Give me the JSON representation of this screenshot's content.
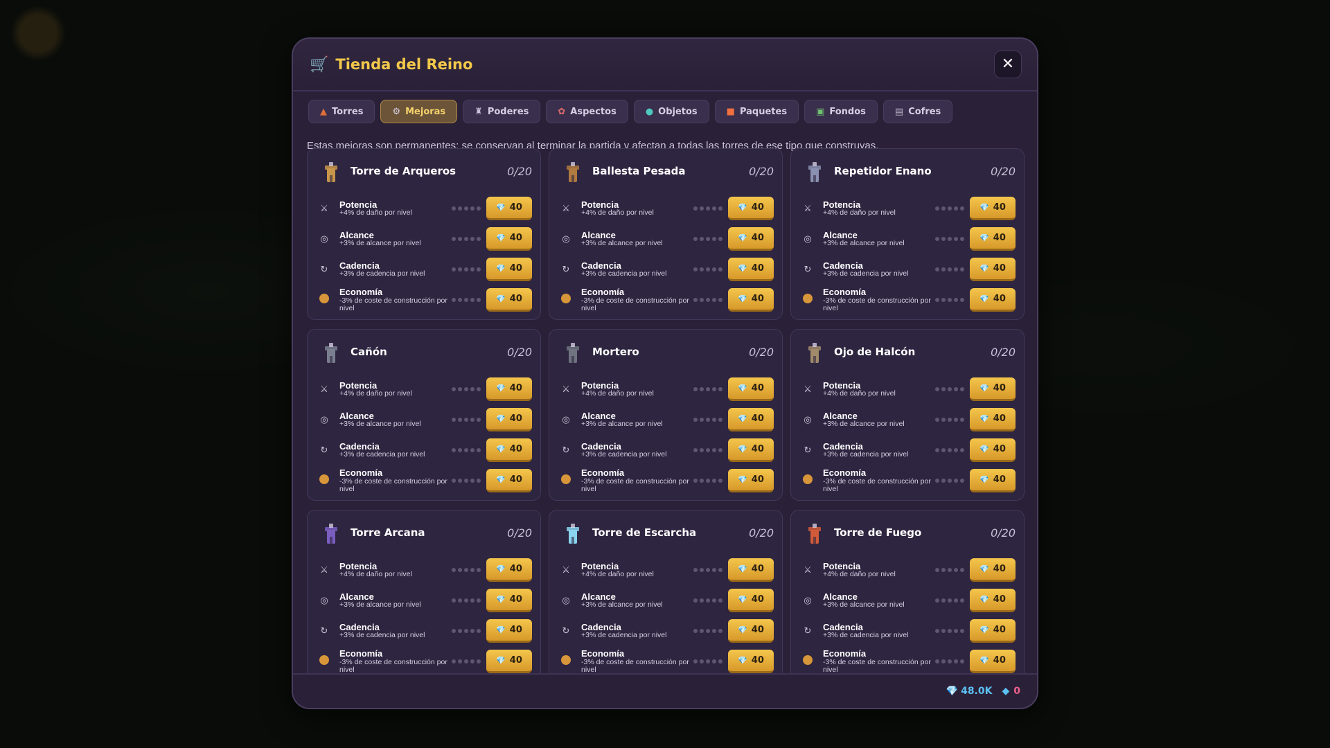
{
  "title": "Tienda del Reino",
  "icons": {
    "cart": "shopping-cart-icon",
    "close": "close-icon"
  },
  "close_label": "✕",
  "tabs": [
    {
      "label": "Torres",
      "icon": "tower-icon",
      "glyph": "▲",
      "color": "#e0703a",
      "active": false
    },
    {
      "label": "Mejoras",
      "icon": "gear-icon",
      "glyph": "⚙",
      "color": "#d8cfe6",
      "active": true
    },
    {
      "label": "Poderes",
      "icon": "power-icon",
      "glyph": "♜",
      "color": "#c9bfd8",
      "active": false
    },
    {
      "label": "Aspectos",
      "icon": "palette-icon",
      "glyph": "✿",
      "color": "#e06c6c",
      "active": false
    },
    {
      "label": "Objetos",
      "icon": "potion-icon",
      "glyph": "●",
      "color": "#4fc8c0",
      "active": false
    },
    {
      "label": "Paquetes",
      "icon": "gift-icon",
      "glyph": "■",
      "color": "#f07040",
      "active": false
    },
    {
      "label": "Fondos",
      "icon": "landscape-icon",
      "glyph": "▣",
      "color": "#6fc070",
      "active": false
    },
    {
      "label": "Cofres",
      "icon": "chest-icon",
      "glyph": "▤",
      "color": "#b9b0c8",
      "active": false
    }
  ],
  "info": "Estas mejoras son permanentes: se conservan al terminar la partida y afectan a todas las torres de ese tipo que construyas.",
  "cards": [
    {
      "name": "Torre de Arqueros",
      "level": "0/20",
      "icon": "archer-tower-icon",
      "color": "#c8964a"
    },
    {
      "name": "Ballesta Pesada",
      "level": "0/20",
      "icon": "ballista-icon",
      "color": "#b07a40"
    },
    {
      "name": "Repetidor Enano",
      "level": "0/20",
      "icon": "dwarf-repeater-icon",
      "color": "#8a90b0"
    },
    {
      "name": "Cañón",
      "level": "0/20",
      "icon": "cannon-icon",
      "color": "#7a7f90"
    },
    {
      "name": "Mortero",
      "level": "0/20",
      "icon": "mortar-icon",
      "color": "#6f7480"
    },
    {
      "name": "Ojo de Halcón",
      "level": "0/20",
      "icon": "hawk-eye-icon",
      "color": "#a08a6a"
    },
    {
      "name": "Torre Arcana",
      "level": "0/20",
      "icon": "arcane-tower-icon",
      "color": "#7a5fc0"
    },
    {
      "name": "Torre de Escarcha",
      "level": "0/20",
      "icon": "frost-tower-icon",
      "color": "#8ad4f0"
    },
    {
      "name": "Torre de Fuego",
      "level": "0/20",
      "icon": "fire-tower-icon",
      "color": "#d05a3a"
    }
  ],
  "upgrades": [
    {
      "name": "Potencia",
      "desc": "+4% de daño por nivel",
      "icon": "crossed-swords-icon",
      "glyph": "⚔",
      "progress": 0,
      "max": 5,
      "price": "40"
    },
    {
      "name": "Alcance",
      "desc": "+3% de alcance por nivel",
      "icon": "target-icon",
      "glyph": "◎",
      "progress": 0,
      "max": 5,
      "price": "40"
    },
    {
      "name": "Cadencia",
      "desc": "+3% de cadencia por nivel",
      "icon": "refresh-icon",
      "glyph": "↻",
      "progress": 0,
      "max": 5,
      "price": "40"
    },
    {
      "name": "Economía",
      "desc": "-3% de coste de construcción por nivel",
      "icon": "coin-icon",
      "glyph": "",
      "progress": 0,
      "max": 5,
      "price": "40"
    }
  ],
  "footer": {
    "gems": "48.0K",
    "gems_icon": "gem-icon",
    "crystals": "0",
    "crystals_icon": "crystal-icon",
    "gem_color": "#5cc0f2",
    "crystal_color": "#f0608c"
  }
}
